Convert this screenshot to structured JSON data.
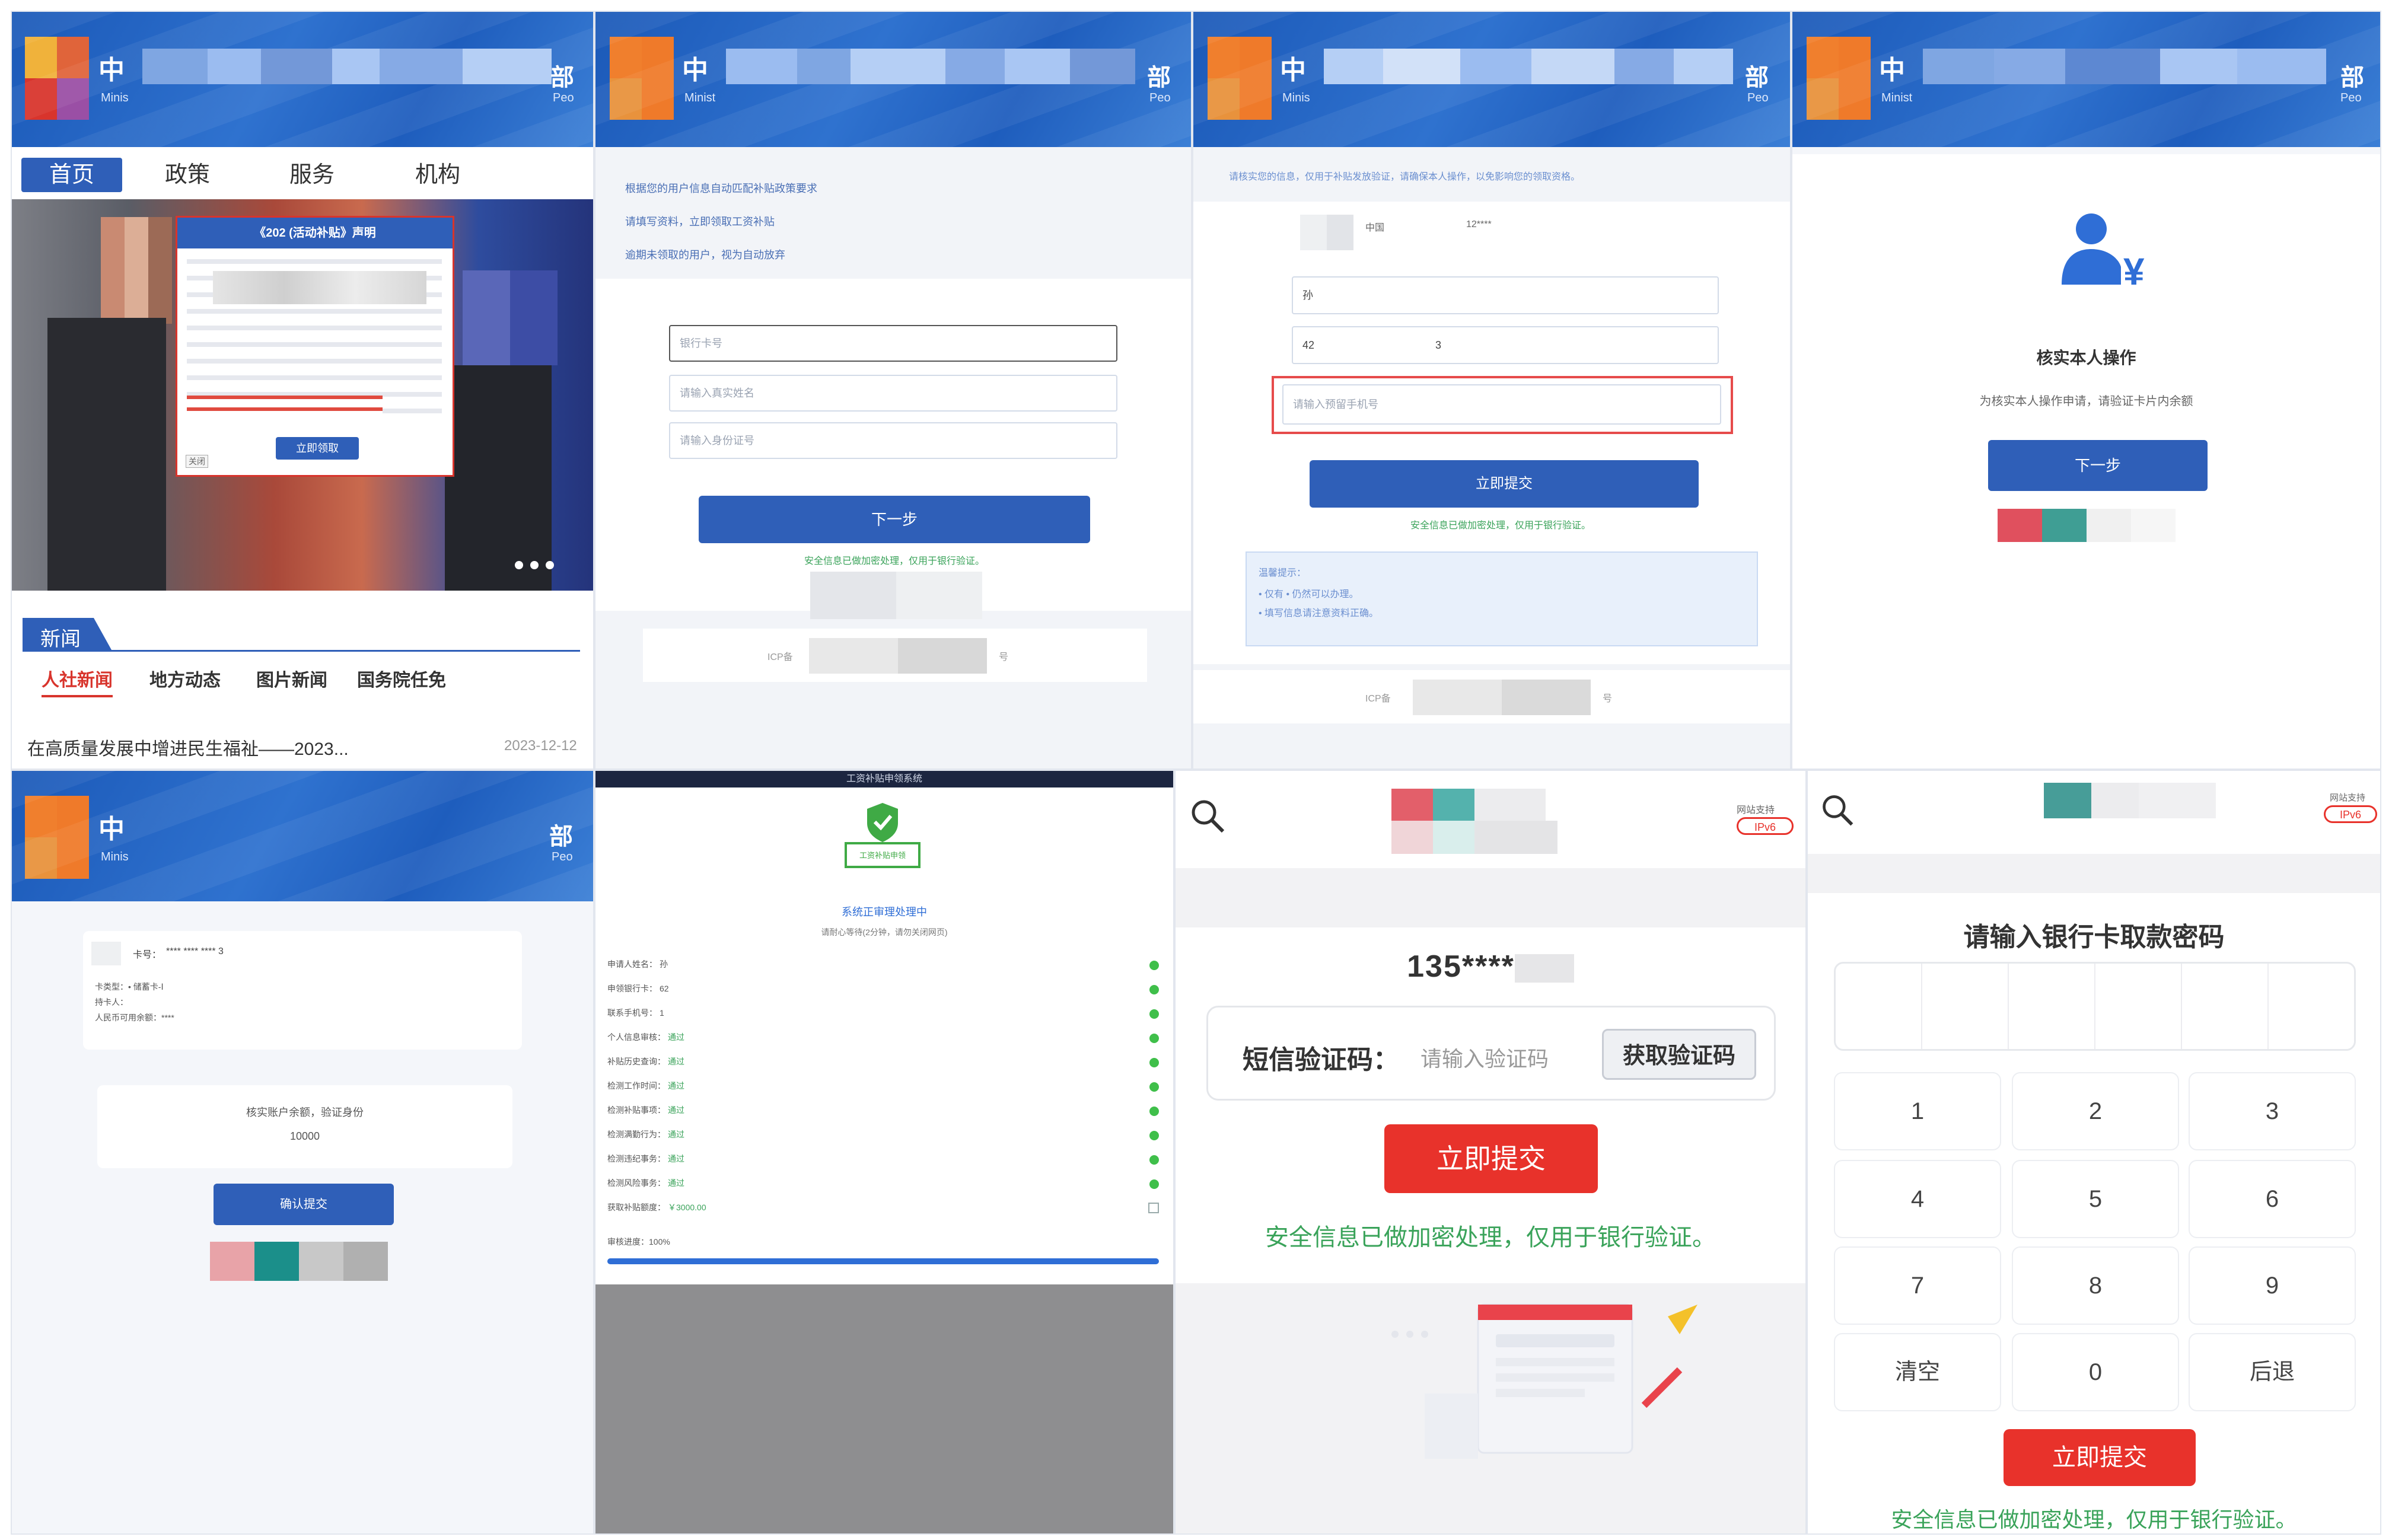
{
  "p1": {
    "header": {
      "brand": "中",
      "brand_right": "部",
      "sub_left": "Minis",
      "sub_right": "Peo"
    },
    "nav": [
      {
        "label": "首页"
      },
      {
        "label": "政策"
      },
      {
        "label": "服务"
      },
      {
        "label": "机构"
      }
    ],
    "notice": {
      "title": "《202 (活动补贴》声明",
      "button": "立即领取",
      "close": "关闭"
    },
    "news": {
      "section": "新闻",
      "tabs": [
        {
          "label": "人社新闻"
        },
        {
          "label": "地方动态"
        },
        {
          "label": "图片新闻"
        },
        {
          "label": "国务院任免"
        }
      ],
      "item": {
        "title": "在高质量发展中增进民生福祉——2023...",
        "date": "2023-12-12"
      }
    }
  },
  "p2": {
    "header": {
      "brand": "中",
      "brand_right": "部",
      "sub_left": "Minist",
      "sub_right": "Peo"
    },
    "bullets": [
      {
        "text": "根据您的用户信息自动匹配补贴政策要求"
      },
      {
        "text": "请填写资料，立即领取工资补贴"
      },
      {
        "text": "逾期未领取的用户，视为自动放弃"
      }
    ],
    "fields": {
      "card": "银行卡号",
      "name": "请输入真实姓名",
      "id": "请输入身份证号"
    },
    "next": "下一步",
    "secure": "安全信息已做加密处理，仅用于银行验证。",
    "footer_left": "ICP备",
    "footer_right": "号"
  },
  "p3": {
    "header": {
      "brand": "中",
      "brand_right": "部",
      "sub_left": "Minis",
      "sub_right": "Peo"
    },
    "tip": "请核实您的信息，仅用于补贴发放验证，请确保本人操作，以免影响您的领取资格。",
    "row": {
      "country": "中国",
      "masked": "12****"
    },
    "fields": {
      "name": "孙",
      "id_left": "42",
      "id_right": "3",
      "phone": "请输入预留手机号"
    },
    "submit": "立即提交",
    "secure": "安全信息已做加密处理，仅用于银行验证。",
    "hint_title": "温馨提示：",
    "hints": [
      {
        "text": "• 仅有 • 仍然可以办理。"
      },
      {
        "text": "• 填写信息请注意资料正确。"
      }
    ],
    "footer_left": "ICP备",
    "footer_right": "号"
  },
  "p4": {
    "header": {
      "brand": "中",
      "brand_right": "部",
      "sub_left": "Minist",
      "sub_right": "Peo"
    },
    "title": "核实本人操作",
    "desc": "为核实本人操作申请，请验证卡片内余额",
    "next": "下一步"
  },
  "p5": {
    "header": {
      "brand": "中",
      "brand_right": "部",
      "sub_left": "Minis",
      "sub_right": "Peo"
    },
    "card_label": "卡号：",
    "card_value": "**** **** **** 3",
    "rows": [
      {
        "text": "卡类型：• 储蓄卡-Ⅰ"
      },
      {
        "text": "持卡人："
      },
      {
        "text": "人民币可用余额：****"
      }
    ],
    "balance_label": "核实账户余额，验证身份",
    "balance_value": "10000",
    "confirm": "确认提交"
  },
  "p6": {
    "top": "工资补贴申领系统",
    "badge": "工资补贴申领",
    "status": "系统正审理处理中",
    "wait": "请耐心等待(2分钟，请勿关闭网页)",
    "rows": [
      {
        "label": "申请人姓名：",
        "value": "孙"
      },
      {
        "label": "申领银行卡：",
        "value": "62"
      },
      {
        "label": "联系手机号：",
        "value": "1"
      },
      {
        "label": "个人信息审核：",
        "value": "通过"
      },
      {
        "label": "补贴历史查询：",
        "value": "通过"
      },
      {
        "label": "检测工作时间：",
        "value": "通过"
      },
      {
        "label": "检测补贴事项：",
        "value": "通过"
      },
      {
        "label": "检测满勤行为：",
        "value": "通过"
      },
      {
        "label": "检测违纪事务：",
        "value": "通过"
      },
      {
        "label": "检测风险事务：",
        "value": "通过"
      },
      {
        "label": "获取补贴额度：",
        "value": "￥3000.00"
      }
    ],
    "progress_label": "审核进度：100%",
    "progress": 1.0
  },
  "p7": {
    "ipv6": "IPv6",
    "ipv6_top": "网站支持",
    "phone": "135****",
    "sms_label": "短信验证码：",
    "sms_placeholder": "请输入验证码",
    "get_code": "获取验证码",
    "submit": "立即提交",
    "secure": "安全信息已做加密处理，仅用于银行验证。"
  },
  "p8": {
    "ipv6": "IPv6",
    "ipv6_top": "网站支持",
    "title": "请输入银行卡取款密码",
    "keys": [
      {
        "k": "1"
      },
      {
        "k": "2"
      },
      {
        "k": "3"
      },
      {
        "k": "4"
      },
      {
        "k": "5"
      },
      {
        "k": "6"
      },
      {
        "k": "7"
      },
      {
        "k": "8"
      },
      {
        "k": "9"
      },
      {
        "k": "清空"
      },
      {
        "k": "0"
      },
      {
        "k": "后退"
      }
    ],
    "submit": "立即提交",
    "secure": "安全信息已做加密处理，仅用于银行验证。"
  },
  "colors": {
    "primary": "#2f5fb8",
    "danger": "#e8322b",
    "success": "#3fbf4a",
    "header": "#1b59b8"
  }
}
